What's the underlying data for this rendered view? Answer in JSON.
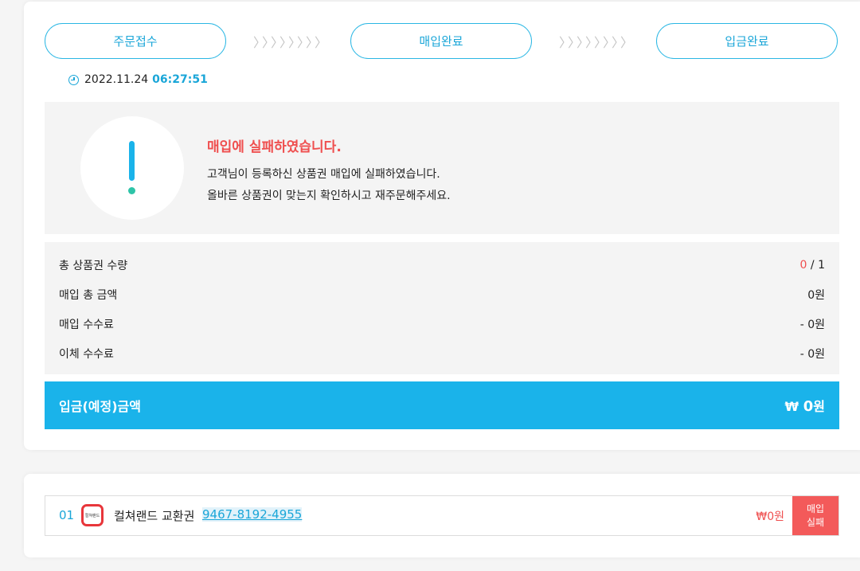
{
  "progress": {
    "steps": [
      {
        "label": "주문접수"
      },
      {
        "label": "매입완료"
      },
      {
        "label": "입금완료"
      }
    ],
    "arrow_glyph": "〉"
  },
  "order_time": {
    "date": "2022.11.24",
    "time": "06:27:51"
  },
  "notice": {
    "title": "매입에 실패하였습니다.",
    "line1": "고객님이 등록하신 상품권 매입에 실패하였습니다.",
    "line2": "올바른 상품권이 맞는지 확인하시고 재주문해주세요."
  },
  "summary": {
    "rows": [
      {
        "label": "총 상품권 수량",
        "value_red": "0",
        "value_rest": " / 1"
      },
      {
        "label": "매입 총 금액",
        "value": "0원"
      },
      {
        "label": "매입 수수료",
        "value": "- 0원"
      },
      {
        "label": "이체 수수료",
        "value": "- 0원"
      }
    ]
  },
  "total": {
    "label": "입금(예정)금액",
    "currency": "₩",
    "amount": "0",
    "unit": "원"
  },
  "items": [
    {
      "no": "01",
      "brand_logo_text": "컬쳐랜드",
      "name": "컬쳐랜드 교환권",
      "code": "9467-8192-4955",
      "price": "₩0원",
      "status_line1": "매입",
      "status_line2": "실패"
    }
  ],
  "colors": {
    "accent": "#1ab3ea",
    "error": "#ef4f4f",
    "badge": "#f35a5a"
  }
}
